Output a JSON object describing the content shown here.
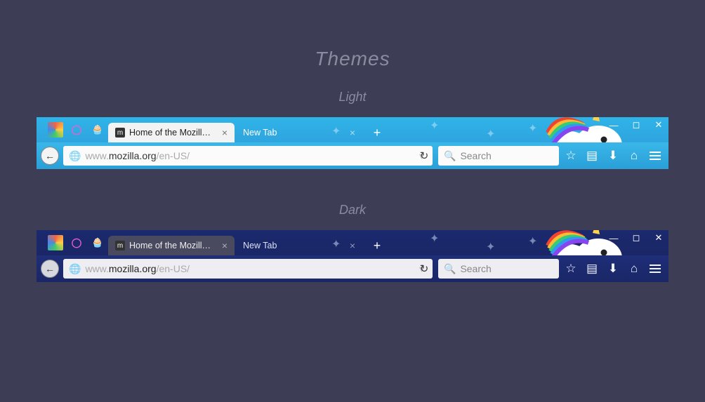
{
  "headings": {
    "main": "Themes",
    "light": "Light",
    "dark": "Dark"
  },
  "tabs": {
    "active": {
      "label": "Home of the Mozill…",
      "favicon_letter": "m"
    },
    "background": {
      "label": "New Tab"
    }
  },
  "url": {
    "prefix": "www.",
    "host": "mozilla.org",
    "path": "/en-US/"
  },
  "search": {
    "placeholder": "Search"
  },
  "icons": {
    "back": "←",
    "globe": "🌐",
    "dropdown": "▾",
    "reload": "↻",
    "magnifier": "🔍",
    "star": "☆",
    "list": "▤",
    "download": "⬇",
    "home": "⌂",
    "close": "×",
    "plus": "+",
    "minimize": "—",
    "maximize": "◻",
    "win_close": "✕",
    "ring": "◯",
    "cupcake": "🧁"
  }
}
